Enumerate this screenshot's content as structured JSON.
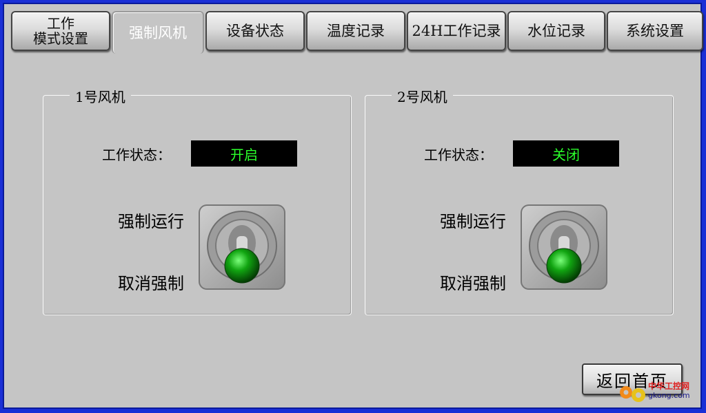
{
  "tabs": [
    {
      "label": "工作\n模式设置",
      "active": false
    },
    {
      "label": "强制风机",
      "active": true
    },
    {
      "label": "设备状态",
      "active": false
    },
    {
      "label": "温度记录",
      "active": false
    },
    {
      "label": "24H工作记录",
      "active": false
    },
    {
      "label": "水位记录",
      "active": false
    },
    {
      "label": "系统设置",
      "active": false
    }
  ],
  "fans": [
    {
      "title": "1号风机",
      "status_label": "工作状态：",
      "status_value": "开启",
      "run_label": "强制运行",
      "cancel_label": "取消强制"
    },
    {
      "title": "2号风机",
      "status_label": "工作状态：",
      "status_value": "关闭",
      "run_label": "强制运行",
      "cancel_label": "取消强制"
    }
  ],
  "return_button": "返回首页",
  "watermark": {
    "line1": "中华工控网",
    "line2": "gkong.com"
  },
  "colors": {
    "status_text": "#2bff2b",
    "indicator": "#11a411",
    "frame": "#1a2fd6"
  }
}
